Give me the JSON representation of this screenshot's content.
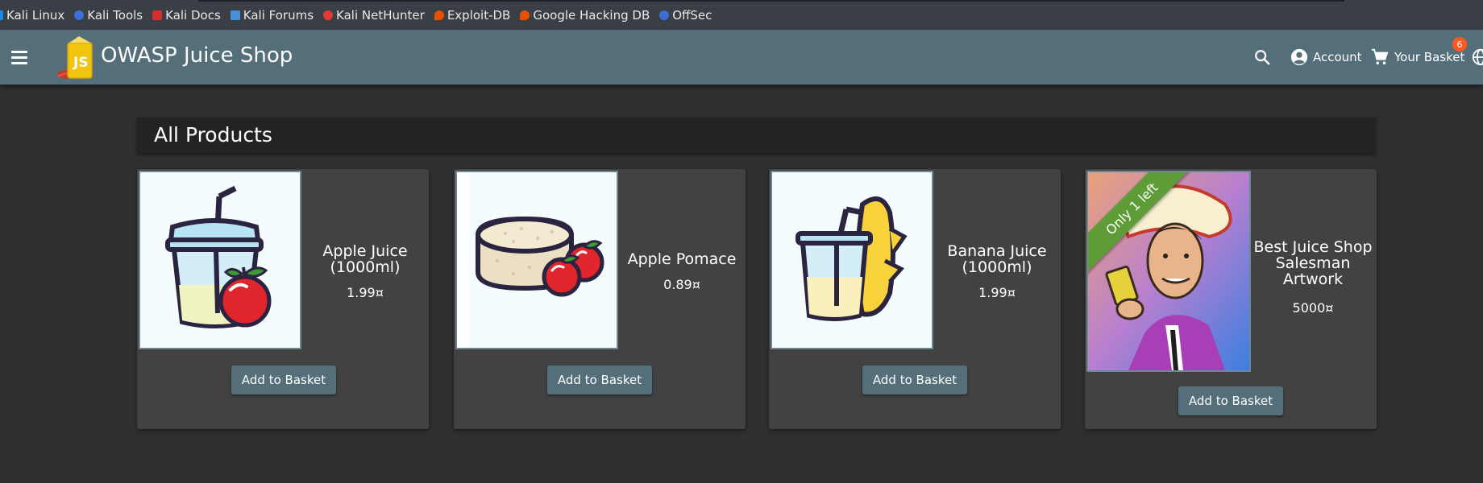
{
  "bookmarks": [
    {
      "label": "Kali Linux",
      "icon": "kali-dragon-icon",
      "color": "#1e88e5"
    },
    {
      "label": "Kali Tools",
      "icon": "kali-tools-icon",
      "color": "#3f6fd8"
    },
    {
      "label": "Kali Docs",
      "icon": "kali-docs-icon",
      "color": "#d32f2f"
    },
    {
      "label": "Kali Forums",
      "icon": "kali-forums-icon",
      "color": "#4a90d9"
    },
    {
      "label": "Kali NetHunter",
      "icon": "kali-nethunter-icon",
      "color": "#e53935"
    },
    {
      "label": "Exploit-DB",
      "icon": "exploit-db-icon",
      "color": "#e65100"
    },
    {
      "label": "Google Hacking DB",
      "icon": "ghdb-icon",
      "color": "#e65100"
    },
    {
      "label": "OffSec",
      "icon": "offsec-icon",
      "color": "#3d6fd0"
    }
  ],
  "toolbar": {
    "title": "OWASP Juice Shop",
    "account_label": "Account",
    "basket_label": "Your Basket",
    "basket_count": "6",
    "accent": "#546e7a"
  },
  "main": {
    "heading": "All Products",
    "add_label": "Add to Basket",
    "products": [
      {
        "name": "Apple Juice (1000ml)",
        "price": "1.99¤",
        "image": "apple-juice-image"
      },
      {
        "name": "Apple Pomace",
        "price": "0.89¤",
        "image": "apple-pomace-image"
      },
      {
        "name": "Banana Juice (1000ml)",
        "price": "1.99¤",
        "image": "banana-juice-image"
      },
      {
        "name": "Best Juice Shop Salesman Artwork",
        "price": "5000¤",
        "image": "salesman-artwork-image",
        "ribbon": "Only 1 left"
      }
    ]
  }
}
